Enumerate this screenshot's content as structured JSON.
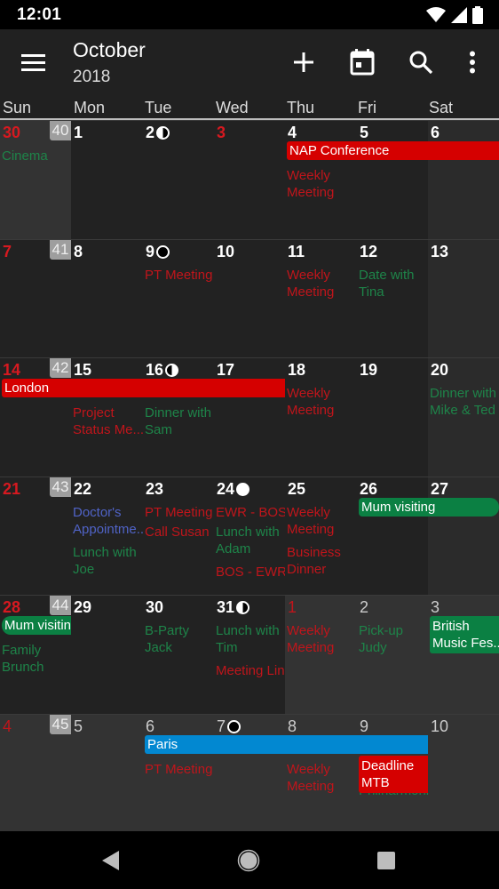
{
  "status_bar": {
    "time": "12:01",
    "icons": [
      "wifi-icon",
      "signal-icon",
      "battery-icon"
    ]
  },
  "app_bar": {
    "month": "October",
    "year": "2018",
    "actions": [
      "add-icon",
      "today-calendar-icon",
      "search-icon",
      "more-vert-icon"
    ]
  },
  "weekdays": [
    "Sun",
    "Mon",
    "Tue",
    "Wed",
    "Thu",
    "Fri",
    "Sat"
  ],
  "colors": {
    "red": "#d50000",
    "green": "#0b8043",
    "blue": "#0288d1",
    "sunday_red": "#d71920"
  },
  "weeks": [
    {
      "week_number": "40",
      "days": [
        {
          "num": "30",
          "style": "red",
          "events": [
            {
              "text": "Cinema",
              "color": "green"
            }
          ]
        },
        {
          "num": "1",
          "events": []
        },
        {
          "num": "2",
          "moon": "half-left",
          "events": []
        },
        {
          "num": "3",
          "style": "red",
          "events": []
        },
        {
          "num": "4",
          "events": [
            {
              "text": "Weekly Meeting",
              "color": "red",
              "lines": [
                "Weekly",
                "Meeting"
              ]
            }
          ]
        },
        {
          "num": "5",
          "events": []
        },
        {
          "num": "6",
          "events": []
        }
      ],
      "bars": [
        {
          "text": "NAP Conference",
          "color": "red",
          "start": 4,
          "end": 6
        }
      ]
    },
    {
      "week_number": "41",
      "days": [
        {
          "num": "7",
          "style": "red",
          "events": []
        },
        {
          "num": "8",
          "events": []
        },
        {
          "num": "9",
          "moon": "new",
          "events": [
            {
              "text": "PT Meeting",
              "color": "red"
            }
          ]
        },
        {
          "num": "10",
          "events": []
        },
        {
          "num": "11",
          "events": [
            {
              "text": "Weekly Meeting",
              "color": "red",
              "lines": [
                "Weekly",
                "Meeting"
              ]
            }
          ]
        },
        {
          "num": "12",
          "events": [
            {
              "text": "Date with Tina",
              "color": "green",
              "lines": [
                "Date with",
                "Tina"
              ]
            }
          ]
        },
        {
          "num": "13",
          "events": []
        }
      ],
      "bars": []
    },
    {
      "week_number": "42",
      "days": [
        {
          "num": "14",
          "style": "red",
          "events": []
        },
        {
          "num": "15",
          "events": [
            {
              "text": "Project Status Meeting",
              "color": "red",
              "lines": [
                "Project",
                "Status Me..."
              ]
            }
          ]
        },
        {
          "num": "16",
          "moon": "half-right",
          "events": [
            {
              "text": "Dinner with Sam",
              "color": "green",
              "lines": [
                "Dinner with",
                "Sam"
              ]
            }
          ]
        },
        {
          "num": "17",
          "events": []
        },
        {
          "num": "18",
          "events": [
            {
              "text": "Weekly Meeting",
              "color": "red",
              "lines": [
                "Weekly",
                "Meeting"
              ]
            }
          ]
        },
        {
          "num": "19",
          "events": []
        },
        {
          "num": "20",
          "events": [
            {
              "text": "Dinner with Mike & Ted",
              "color": "green",
              "lines": [
                "Dinner with",
                "Mike & Ted"
              ]
            }
          ]
        }
      ],
      "bars": [
        {
          "text": "London",
          "color": "red",
          "start": 0,
          "end": 3
        }
      ]
    },
    {
      "week_number": "43",
      "days": [
        {
          "num": "21",
          "style": "red",
          "events": []
        },
        {
          "num": "22",
          "events": [
            {
              "text": "Doctor's Appointment",
              "color": "blue",
              "lines": [
                "Doctor's",
                "Appointme..."
              ]
            },
            {
              "text": "Lunch with Joe",
              "color": "green",
              "lines": [
                "Lunch with",
                "Joe"
              ]
            }
          ]
        },
        {
          "num": "23",
          "events": [
            {
              "text": "PT Meeting",
              "color": "red"
            },
            {
              "text": "Call Susan",
              "color": "red"
            }
          ]
        },
        {
          "num": "24",
          "moon": "full",
          "events": [
            {
              "text": "EWR - BOS",
              "color": "red"
            },
            {
              "text": "Lunch with Adam",
              "color": "green",
              "lines": [
                "Lunch with",
                "Adam"
              ]
            },
            {
              "text": "BOS - EWR",
              "color": "red"
            }
          ]
        },
        {
          "num": "25",
          "events": [
            {
              "text": "Weekly Meeting",
              "color": "red",
              "lines": [
                "Weekly",
                "Meeting"
              ]
            },
            {
              "text": "Business Dinner",
              "color": "red",
              "lines": [
                "Business",
                "Dinner"
              ]
            }
          ]
        },
        {
          "num": "26",
          "events": []
        },
        {
          "num": "27",
          "events": []
        }
      ],
      "bars": [
        {
          "text": "Mum visiting",
          "color": "green",
          "start": 5,
          "end": 6
        }
      ]
    },
    {
      "week_number": "44",
      "days": [
        {
          "num": "28",
          "style": "red",
          "events": [
            {
              "text": "Family Brunch",
              "color": "green",
              "lines": [
                "Family",
                "Brunch"
              ]
            }
          ]
        },
        {
          "num": "29",
          "events": []
        },
        {
          "num": "30",
          "events": [
            {
              "text": "B-Party Jack",
              "color": "green",
              "lines": [
                "B-Party",
                "Jack"
              ]
            }
          ]
        },
        {
          "num": "31",
          "moon": "half-left",
          "events": [
            {
              "text": "Lunch with Tim",
              "color": "green",
              "lines": [
                "Lunch with",
                "Tim"
              ]
            },
            {
              "text": "Meeting Lin",
              "color": "red"
            }
          ]
        },
        {
          "num": "1",
          "style": "dimred",
          "other": true,
          "events": [
            {
              "text": "Weekly Meeting",
              "color": "red",
              "lines": [
                "Weekly",
                "Meeting"
              ]
            }
          ]
        },
        {
          "num": "2",
          "style": "dim",
          "other": true,
          "events": [
            {
              "text": "Pick-up Judy",
              "color": "green",
              "lines": [
                "Pick-up",
                "Judy"
              ]
            }
          ]
        },
        {
          "num": "3",
          "style": "dim",
          "other": true,
          "events": []
        }
      ],
      "bars": [
        {
          "text": "Mum visitin",
          "color": "green",
          "start": 0,
          "end": 0
        },
        {
          "text": "British Music Fes...",
          "color": "green",
          "start": 6,
          "end": 6,
          "lines": [
            "British",
            "Music Fes..."
          ]
        }
      ]
    },
    {
      "week_number": "45",
      "days": [
        {
          "num": "4",
          "style": "dimred",
          "other": true,
          "events": []
        },
        {
          "num": "5",
          "style": "dim",
          "other": true,
          "events": []
        },
        {
          "num": "6",
          "style": "dim",
          "other": true,
          "events": [
            {
              "text": "PT Meeting",
              "color": "red"
            }
          ]
        },
        {
          "num": "7",
          "style": "dim",
          "other": true,
          "moon": "new",
          "events": []
        },
        {
          "num": "8",
          "style": "dim",
          "other": true,
          "events": [
            {
              "text": "Weekly Meeting",
              "color": "red",
              "lines": [
                "Weekly",
                "Meeting"
              ]
            }
          ]
        },
        {
          "num": "9",
          "style": "dim",
          "other": true,
          "events": [
            {
              "text": "Philharmonic",
              "color": "green"
            }
          ]
        },
        {
          "num": "10",
          "style": "dim",
          "other": true,
          "events": []
        }
      ],
      "bars": [
        {
          "text": "Paris",
          "color": "blue",
          "start": 2,
          "end": 5
        },
        {
          "text": "Deadline MTB",
          "color": "red",
          "start": 5,
          "end": 5,
          "lines": [
            "Deadline",
            "MTB"
          ]
        }
      ]
    }
  ],
  "nav_bar": {
    "buttons": [
      "back-icon",
      "home-icon",
      "recents-icon"
    ]
  }
}
